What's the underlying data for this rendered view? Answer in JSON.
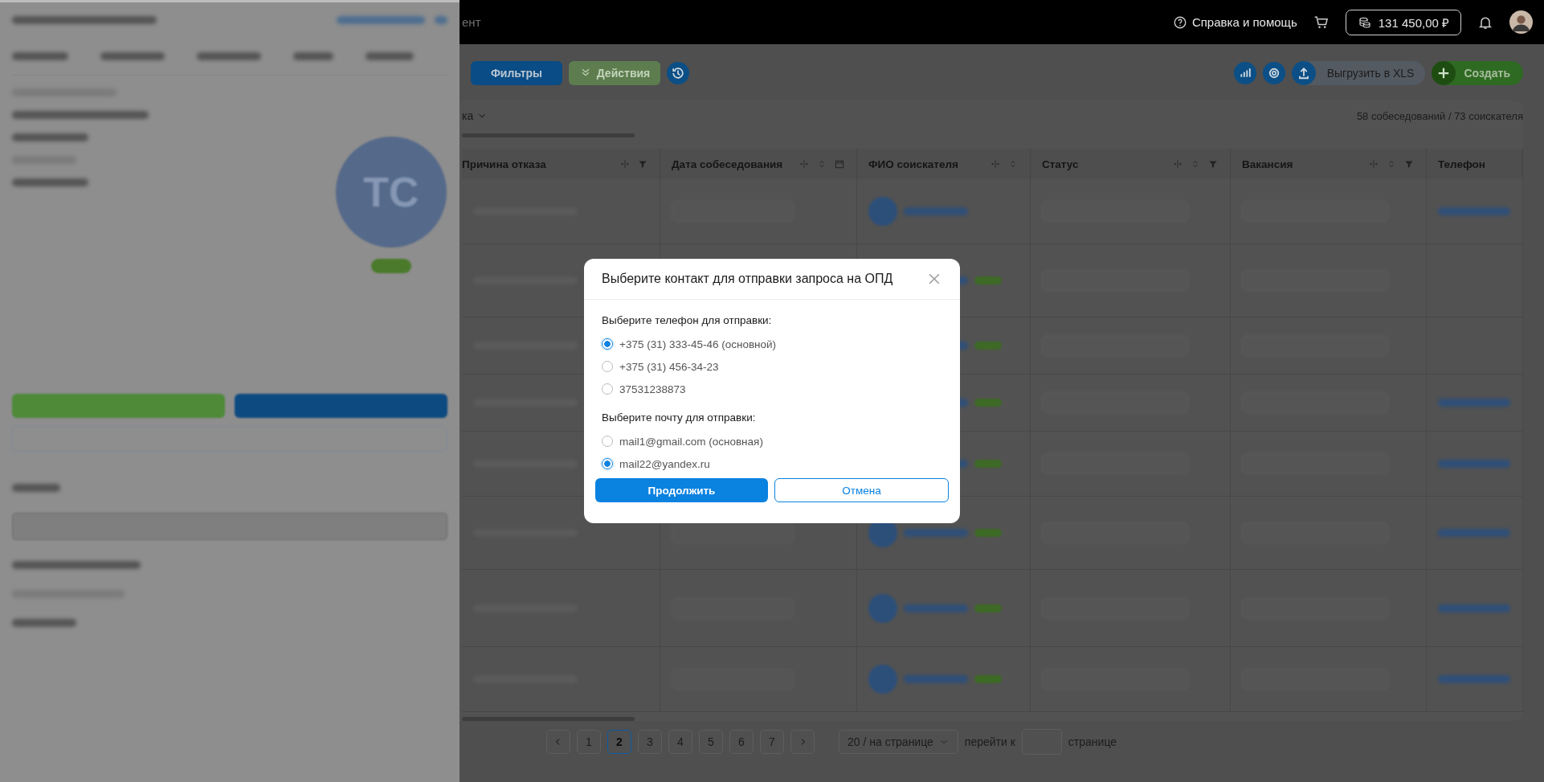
{
  "top_bar": {
    "cut_text": "ент",
    "help": "Справка и помощь",
    "balance": "131 450,00 ₽"
  },
  "toolbar": {
    "left_buttons": [
      {
        "label": "Фильтры",
        "kind": "primary",
        "disabled": false
      },
      {
        "label": "Действия",
        "kind": "success",
        "disabled": true
      }
    ],
    "export_button": "Выгрузить в XLS",
    "create_button": "Создать"
  },
  "table": {
    "filter_text": "ка",
    "summary": "58 собеседований / 73 соискателя",
    "columns": [
      {
        "label": "Причина отказа",
        "kind": "filter"
      },
      {
        "label": "Дата собеседования",
        "kind": "date"
      },
      {
        "label": "ФИО соискателя",
        "kind": "sort"
      },
      {
        "label": "Статус",
        "kind": "sort-filter"
      },
      {
        "label": "Вакансия",
        "kind": "sort-filter"
      },
      {
        "label": "Телефон",
        "kind": "plain"
      }
    ]
  },
  "pagination": {
    "pages": [
      {
        "label": "1",
        "selected": false
      },
      {
        "label": "2",
        "selected": true
      },
      {
        "label": "3",
        "selected": false
      },
      {
        "label": "4",
        "selected": false
      },
      {
        "label": "5",
        "selected": false
      },
      {
        "label": "6",
        "selected": false
      },
      {
        "label": "7",
        "selected": false
      }
    ],
    "page_size": "20 / на странице",
    "goto_label": "перейти к",
    "goto_suffix": "странице"
  },
  "side_panel": {
    "avatar_initials": "TC"
  },
  "dialog": {
    "title": "Выберите контакт для отправки запроса на ОПД",
    "phone_label": "Выберите телефон для отправки:",
    "phones": [
      {
        "label": "+375 (31) 333-45-46 (основной)",
        "selected": true
      },
      {
        "label": "+375 (31) 456-34-23",
        "selected": false
      },
      {
        "label": "37531238873",
        "selected": false
      }
    ],
    "email_label": "Выберите почту для отправки:",
    "emails": [
      {
        "label": "mail1@gmail.com (основная)",
        "selected": false
      },
      {
        "label": "mail22@yandex.ru",
        "selected": true
      }
    ],
    "confirm": "Продолжить",
    "cancel": "Отмена"
  }
}
